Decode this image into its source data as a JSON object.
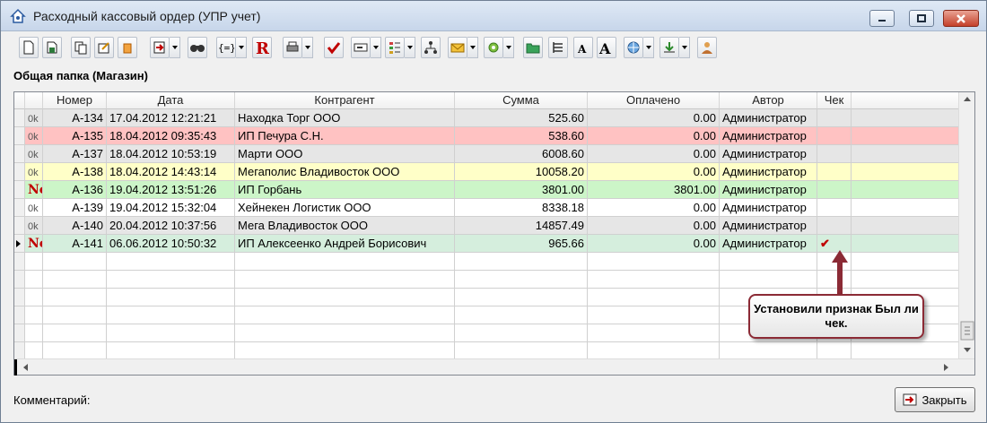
{
  "window": {
    "title": "Расходный кассовый ордер (УПР учет)"
  },
  "folder_title": "Общая папка (Магазин)",
  "columns": [
    "Номер",
    "Дата",
    "Контрагент",
    "Сумма",
    "Оплачено",
    "Автор",
    "Чек"
  ],
  "rows": [
    {
      "status": "0k",
      "number": "А-134",
      "date": "17.04.2012 12:21:21",
      "counterparty": "Находка Торг ООО",
      "sum": "525.60",
      "paid": "0.00",
      "author": "Администратор",
      "check": "",
      "bg": "#e6e6e6"
    },
    {
      "status": "0k",
      "number": "А-135",
      "date": "18.04.2012 09:35:43",
      "counterparty": "ИП Печура С.Н.",
      "sum": "538.60",
      "paid": "0.00",
      "author": "Администратор",
      "check": "",
      "bg": "#ffc2c2"
    },
    {
      "status": "0k",
      "number": "А-137",
      "date": "18.04.2012 10:53:19",
      "counterparty": "Марти ООО",
      "sum": "6008.60",
      "paid": "0.00",
      "author": "Администратор",
      "check": "",
      "bg": "#e6e6e6"
    },
    {
      "status": "0k",
      "number": "А-138",
      "date": "18.04.2012 14:43:14",
      "counterparty": "Мегаполис Владивосток ООО",
      "sum": "10058.20",
      "paid": "0.00",
      "author": "Администратор",
      "check": "",
      "bg": "#ffffc8"
    },
    {
      "status": "No",
      "number": "А-136",
      "date": "19.04.2012 13:51:26",
      "counterparty": "ИП Горбань",
      "sum": "3801.00",
      "paid": "3801.00",
      "author": "Администратор",
      "check": "",
      "bg": "#ccf5c8"
    },
    {
      "status": "0k",
      "number": "А-139",
      "date": "19.04.2012 15:32:04",
      "counterparty": "Хейнекен Логистик ООО",
      "sum": "8338.18",
      "paid": "0.00",
      "author": "Администратор",
      "check": "",
      "bg": "#ffffff"
    },
    {
      "status": "0k",
      "number": "А-140",
      "date": "20.04.2012 10:37:56",
      "counterparty": "Мега Владивосток ООО",
      "sum": "14857.49",
      "paid": "0.00",
      "author": "Администратор",
      "check": "",
      "bg": "#e6e6e6"
    },
    {
      "status": "No",
      "number": "А-141",
      "date": "06.06.2012 10:50:32",
      "counterparty": "ИП Алексеенко Андрей Борисович",
      "sum": "965.66",
      "paid": "0.00",
      "author": "Администратор",
      "check": "✔",
      "bg": "#d5eedd"
    }
  ],
  "callout_text": "Установили признак Был ли чек.",
  "comment_label": "Комментарий:",
  "close_button_label": "Закрыть",
  "colors": {
    "accent_red": "#c00000",
    "callout_border": "#8b2a35"
  }
}
